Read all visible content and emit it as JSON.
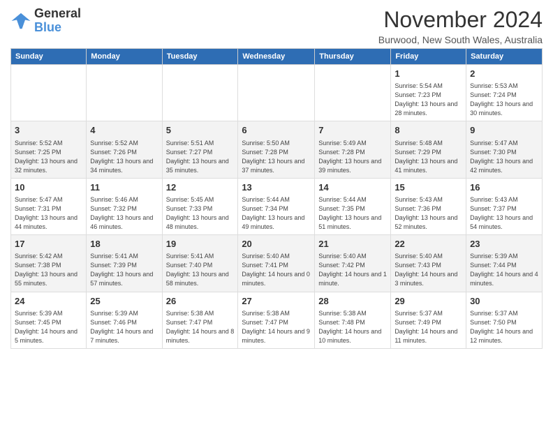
{
  "header": {
    "logo_general": "General",
    "logo_blue": "Blue",
    "title": "November 2024",
    "location": "Burwood, New South Wales, Australia"
  },
  "weekdays": [
    "Sunday",
    "Monday",
    "Tuesday",
    "Wednesday",
    "Thursday",
    "Friday",
    "Saturday"
  ],
  "weeks": [
    [
      {
        "day": "",
        "info": ""
      },
      {
        "day": "",
        "info": ""
      },
      {
        "day": "",
        "info": ""
      },
      {
        "day": "",
        "info": ""
      },
      {
        "day": "",
        "info": ""
      },
      {
        "day": "1",
        "info": "Sunrise: 5:54 AM\nSunset: 7:23 PM\nDaylight: 13 hours\nand 28 minutes."
      },
      {
        "day": "2",
        "info": "Sunrise: 5:53 AM\nSunset: 7:24 PM\nDaylight: 13 hours\nand 30 minutes."
      }
    ],
    [
      {
        "day": "3",
        "info": "Sunrise: 5:52 AM\nSunset: 7:25 PM\nDaylight: 13 hours\nand 32 minutes."
      },
      {
        "day": "4",
        "info": "Sunrise: 5:52 AM\nSunset: 7:26 PM\nDaylight: 13 hours\nand 34 minutes."
      },
      {
        "day": "5",
        "info": "Sunrise: 5:51 AM\nSunset: 7:27 PM\nDaylight: 13 hours\nand 35 minutes."
      },
      {
        "day": "6",
        "info": "Sunrise: 5:50 AM\nSunset: 7:28 PM\nDaylight: 13 hours\nand 37 minutes."
      },
      {
        "day": "7",
        "info": "Sunrise: 5:49 AM\nSunset: 7:28 PM\nDaylight: 13 hours\nand 39 minutes."
      },
      {
        "day": "8",
        "info": "Sunrise: 5:48 AM\nSunset: 7:29 PM\nDaylight: 13 hours\nand 41 minutes."
      },
      {
        "day": "9",
        "info": "Sunrise: 5:47 AM\nSunset: 7:30 PM\nDaylight: 13 hours\nand 42 minutes."
      }
    ],
    [
      {
        "day": "10",
        "info": "Sunrise: 5:47 AM\nSunset: 7:31 PM\nDaylight: 13 hours\nand 44 minutes."
      },
      {
        "day": "11",
        "info": "Sunrise: 5:46 AM\nSunset: 7:32 PM\nDaylight: 13 hours\nand 46 minutes."
      },
      {
        "day": "12",
        "info": "Sunrise: 5:45 AM\nSunset: 7:33 PM\nDaylight: 13 hours\nand 48 minutes."
      },
      {
        "day": "13",
        "info": "Sunrise: 5:44 AM\nSunset: 7:34 PM\nDaylight: 13 hours\nand 49 minutes."
      },
      {
        "day": "14",
        "info": "Sunrise: 5:44 AM\nSunset: 7:35 PM\nDaylight: 13 hours\nand 51 minutes."
      },
      {
        "day": "15",
        "info": "Sunrise: 5:43 AM\nSunset: 7:36 PM\nDaylight: 13 hours\nand 52 minutes."
      },
      {
        "day": "16",
        "info": "Sunrise: 5:43 AM\nSunset: 7:37 PM\nDaylight: 13 hours\nand 54 minutes."
      }
    ],
    [
      {
        "day": "17",
        "info": "Sunrise: 5:42 AM\nSunset: 7:38 PM\nDaylight: 13 hours\nand 55 minutes."
      },
      {
        "day": "18",
        "info": "Sunrise: 5:41 AM\nSunset: 7:39 PM\nDaylight: 13 hours\nand 57 minutes."
      },
      {
        "day": "19",
        "info": "Sunrise: 5:41 AM\nSunset: 7:40 PM\nDaylight: 13 hours\nand 58 minutes."
      },
      {
        "day": "20",
        "info": "Sunrise: 5:40 AM\nSunset: 7:41 PM\nDaylight: 14 hours\nand 0 minutes."
      },
      {
        "day": "21",
        "info": "Sunrise: 5:40 AM\nSunset: 7:42 PM\nDaylight: 14 hours\nand 1 minute."
      },
      {
        "day": "22",
        "info": "Sunrise: 5:40 AM\nSunset: 7:43 PM\nDaylight: 14 hours\nand 3 minutes."
      },
      {
        "day": "23",
        "info": "Sunrise: 5:39 AM\nSunset: 7:44 PM\nDaylight: 14 hours\nand 4 minutes."
      }
    ],
    [
      {
        "day": "24",
        "info": "Sunrise: 5:39 AM\nSunset: 7:45 PM\nDaylight: 14 hours\nand 5 minutes."
      },
      {
        "day": "25",
        "info": "Sunrise: 5:39 AM\nSunset: 7:46 PM\nDaylight: 14 hours\nand 7 minutes."
      },
      {
        "day": "26",
        "info": "Sunrise: 5:38 AM\nSunset: 7:47 PM\nDaylight: 14 hours\nand 8 minutes."
      },
      {
        "day": "27",
        "info": "Sunrise: 5:38 AM\nSunset: 7:47 PM\nDaylight: 14 hours\nand 9 minutes."
      },
      {
        "day": "28",
        "info": "Sunrise: 5:38 AM\nSunset: 7:48 PM\nDaylight: 14 hours\nand 10 minutes."
      },
      {
        "day": "29",
        "info": "Sunrise: 5:37 AM\nSunset: 7:49 PM\nDaylight: 14 hours\nand 11 minutes."
      },
      {
        "day": "30",
        "info": "Sunrise: 5:37 AM\nSunset: 7:50 PM\nDaylight: 14 hours\nand 12 minutes."
      }
    ]
  ]
}
